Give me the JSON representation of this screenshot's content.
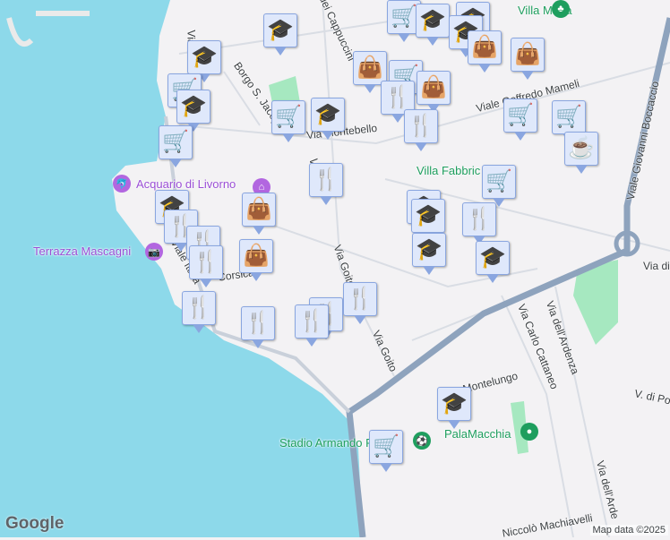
{
  "labels": {
    "villa_maria": "Villa Maria",
    "viale_mameli": "Viale Goffredo Mameli",
    "via_montebello": "Via Montebello",
    "villa_fabbricotti": "Villa Fabbric",
    "acquario": "Acquario di Livorno",
    "terrazza": "Terrazza Mascagni",
    "via_goito_1": "Via Goito",
    "via_goito_2": "Via Goito",
    "boccaccio": "Viale Giovanni Boccaccio",
    "via_di": "Via di",
    "ardenza_1": "Via dell'Ardenza",
    "ardenza_2": "Via dell'Arde",
    "cattaneo": "Via Carlo Cattaneo",
    "v_di_pop": "V. di Pop",
    "montelungo": "Montelungo",
    "palamacchia": "PalaMacchia",
    "stadio": "Stadio Armando Picchi",
    "machiavelli": "Niccolò Machiavelli",
    "borgo": "Borgo S. Jacopo",
    "cappuccini": "o dei Cappuccini",
    "corsica": "Corsica",
    "viale_italia": "Viale Italia",
    "via_v": "Via",
    "via_v2": "Vi"
  },
  "markers": [
    "school",
    "school",
    "cart",
    "school",
    "cart",
    "cart",
    "school",
    "restaurant",
    "cart",
    "school",
    "school",
    "school",
    "bag",
    "bag",
    "bag",
    "cart",
    "bag",
    "restaurant",
    "restaurant",
    "cart",
    "cart",
    "cup",
    "cart",
    "school",
    "school",
    "restaurant",
    "school",
    "school",
    "school",
    "restaurant",
    "restaurant",
    "restaurant",
    "bag",
    "bag",
    "restaurant",
    "restaurant",
    "restaurant",
    "restaurant",
    "restaurant",
    "school",
    "cart"
  ],
  "icons": {
    "school": "🎓",
    "cart": "🛒",
    "bag": "👜",
    "restaurant": "🍴",
    "cup": "☕"
  },
  "branding": {
    "logo": "Google",
    "attribution": "Map data ©2025"
  },
  "colors": {
    "water": "#8dd9ea",
    "park": "#a6e8c0",
    "highway": "#8ea3bd",
    "marker_bg": "#dfe8fb",
    "marker_icon": "#0f3f5e"
  }
}
